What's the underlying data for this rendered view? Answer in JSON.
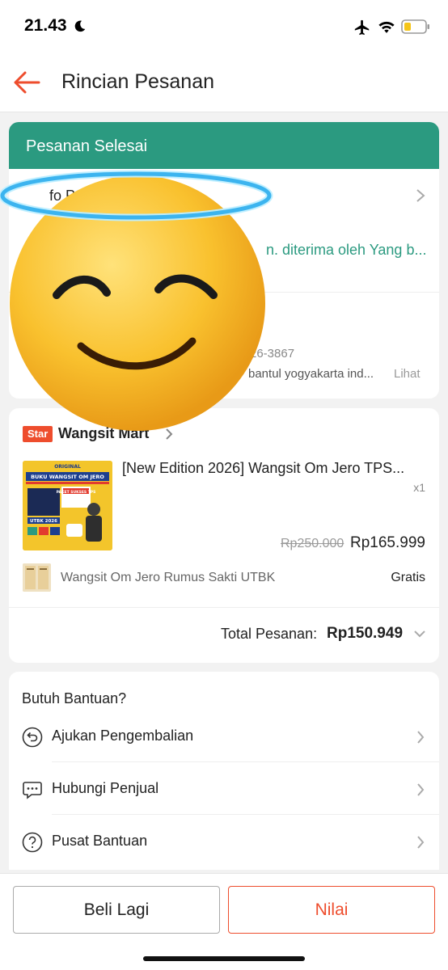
{
  "status_bar": {
    "time": "21.43",
    "icons": [
      "moon-icon",
      "airplane-icon",
      "wifi-icon",
      "battery-icon"
    ]
  },
  "header": {
    "title": "Rincian Pesanan",
    "back_icon": "arrow-left-icon"
  },
  "order_status": {
    "banner": "Pesanan Selesai",
    "shipping_title_partial": "fo Pe",
    "shipping_status_partial": "n. diterima oleh Yang b..."
  },
  "address": {
    "phone_partial": "26-3867",
    "address_partial": "bantul yogyakarta ind...",
    "link": "Lihat"
  },
  "shop": {
    "badge": "Star",
    "name": "Wangsit Mart",
    "product": {
      "name": "[New Edition 2026] Wangsit Om Jero TPS...",
      "qty": "x1",
      "original_price": "Rp250.000",
      "price": "Rp165.999",
      "image_text": {
        "line1": "ORIGINAL",
        "line2": "BUKU WANGSIT OM JERO",
        "line3": "UTBK 2026",
        "line4": "PAKET SUKSES TPS"
      }
    },
    "bonus": {
      "name": "Wangsit Om Jero Rumus Sakti UTBK",
      "price": "Gratis"
    },
    "total_label": "Total Pesanan:",
    "total_value": "Rp150.949"
  },
  "help": {
    "title": "Butuh Bantuan?",
    "items": [
      {
        "label": "Ajukan Pengembalian",
        "icon": "return-icon"
      },
      {
        "label": "Hubungi Penjual",
        "icon": "chat-icon"
      },
      {
        "label": "Pusat Bantuan",
        "icon": "question-icon"
      }
    ]
  },
  "actions": {
    "buy_again": "Beli Lagi",
    "rate": "Nilai"
  },
  "colors": {
    "accent": "#ee4d2d",
    "banner": "#2b9a80"
  }
}
